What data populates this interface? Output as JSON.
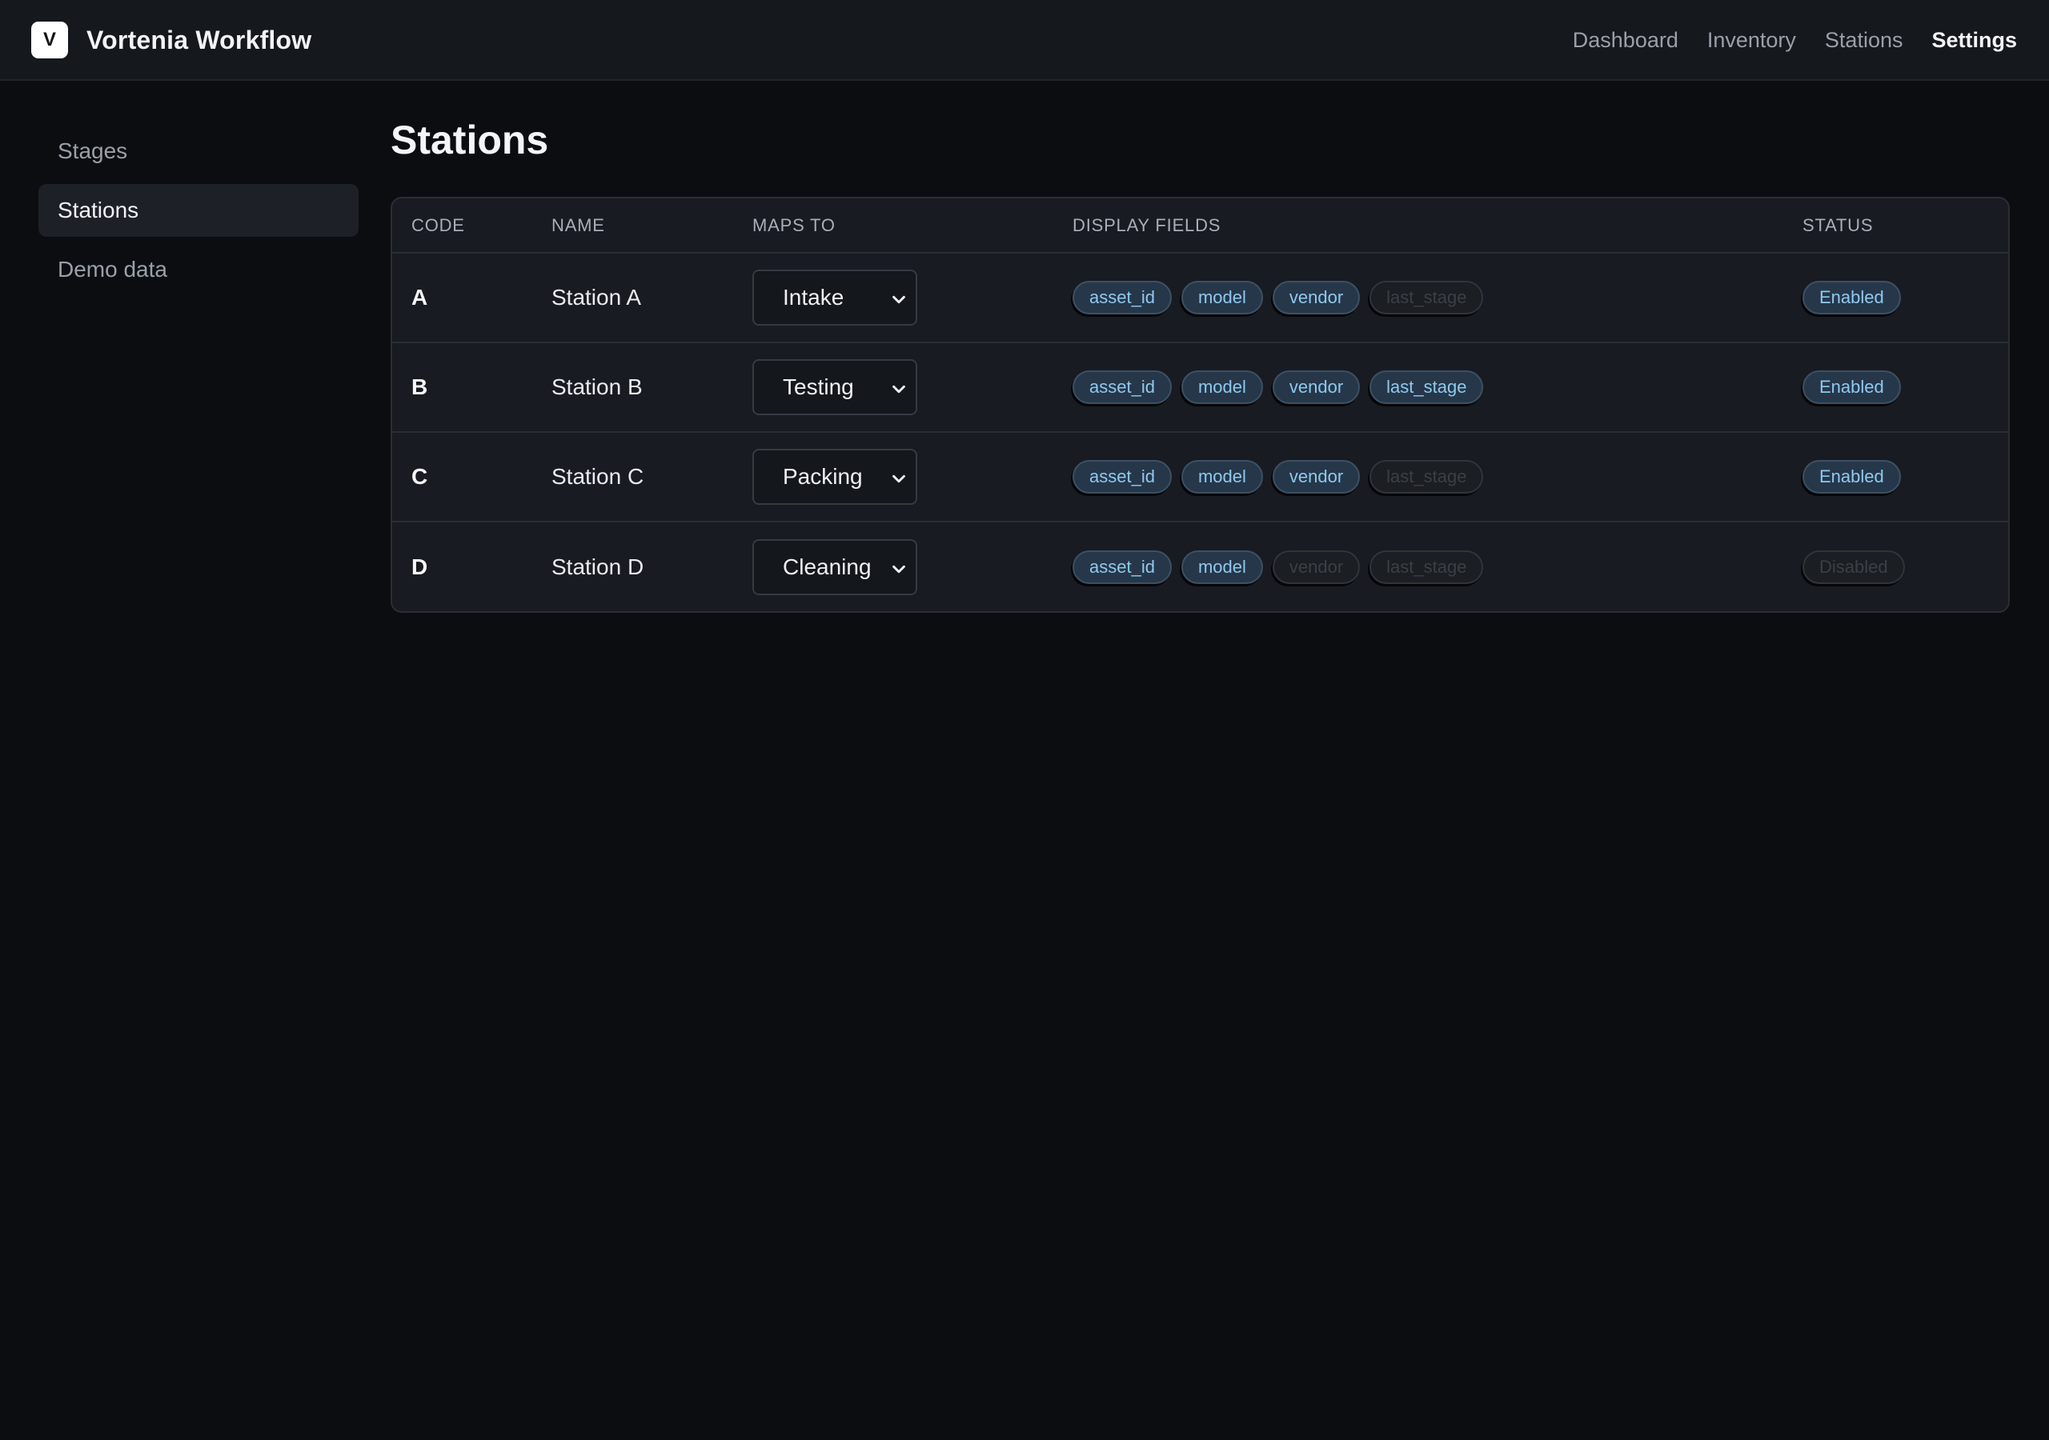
{
  "app": {
    "logo_letter": "V",
    "title": "Vortenia Workflow"
  },
  "topnav": {
    "items": [
      {
        "label": "Dashboard",
        "active": false
      },
      {
        "label": "Inventory",
        "active": false
      },
      {
        "label": "Stations",
        "active": false
      },
      {
        "label": "Settings",
        "active": true
      }
    ]
  },
  "sidebar": {
    "items": [
      {
        "label": "Stages",
        "active": false
      },
      {
        "label": "Stations",
        "active": true
      },
      {
        "label": "Demo data",
        "active": false
      }
    ]
  },
  "page": {
    "title": "Stations"
  },
  "table": {
    "columns": [
      "CODE",
      "NAME",
      "MAPS TO",
      "DISPLAY FIELDS",
      "STATUS"
    ],
    "rows": [
      {
        "code": "A",
        "name": "Station A",
        "maps_to": "Intake",
        "fields": [
          {
            "label": "asset_id",
            "enabled": true
          },
          {
            "label": "model",
            "enabled": true
          },
          {
            "label": "vendor",
            "enabled": true
          },
          {
            "label": "last_stage",
            "enabled": false
          }
        ],
        "status": {
          "label": "Enabled",
          "enabled": true
        }
      },
      {
        "code": "B",
        "name": "Station B",
        "maps_to": "Testing",
        "fields": [
          {
            "label": "asset_id",
            "enabled": true
          },
          {
            "label": "model",
            "enabled": true
          },
          {
            "label": "vendor",
            "enabled": true
          },
          {
            "label": "last_stage",
            "enabled": true
          }
        ],
        "status": {
          "label": "Enabled",
          "enabled": true
        }
      },
      {
        "code": "C",
        "name": "Station C",
        "maps_to": "Packing",
        "fields": [
          {
            "label": "asset_id",
            "enabled": true
          },
          {
            "label": "model",
            "enabled": true
          },
          {
            "label": "vendor",
            "enabled": true
          },
          {
            "label": "last_stage",
            "enabled": false
          }
        ],
        "status": {
          "label": "Enabled",
          "enabled": true
        }
      },
      {
        "code": "D",
        "name": "Station D",
        "maps_to": "Cleaning",
        "fields": [
          {
            "label": "asset_id",
            "enabled": true
          },
          {
            "label": "model",
            "enabled": true
          },
          {
            "label": "vendor",
            "enabled": false
          },
          {
            "label": "last_stage",
            "enabled": false
          }
        ],
        "status": {
          "label": "Disabled",
          "enabled": false
        }
      }
    ]
  },
  "colors": {
    "background": "#0b0d11",
    "topbar": "#15181d",
    "card": "#181b21",
    "chip_on_bg": "#26374a",
    "chip_on_text": "#8fc9ee",
    "chip_off_text": "#3b3f46"
  },
  "icons": {
    "select_arrow": "chevron-down-icon"
  }
}
